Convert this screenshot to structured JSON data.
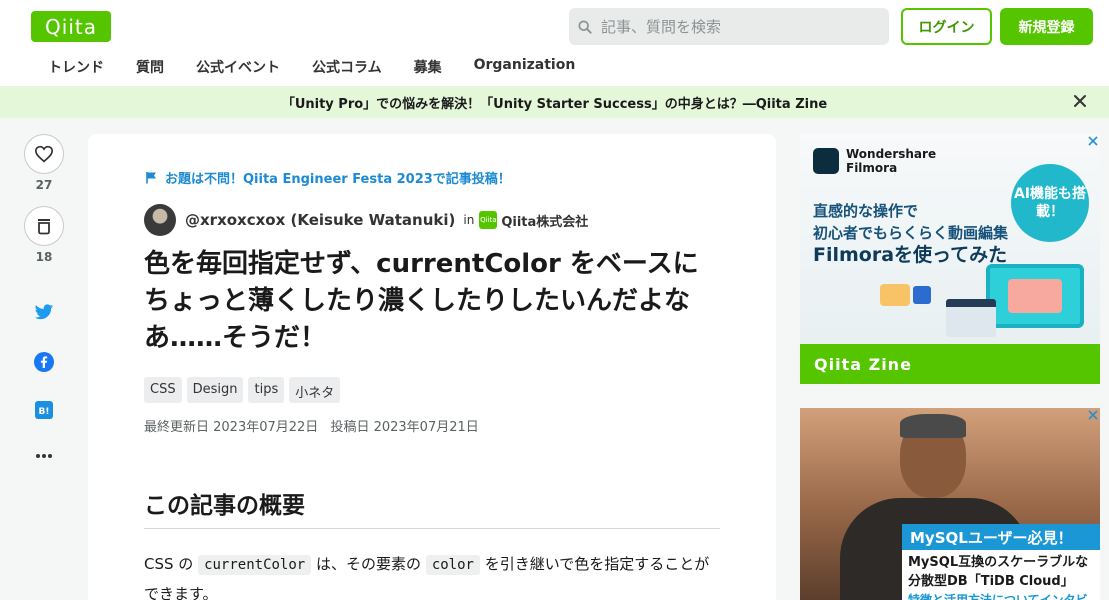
{
  "header": {
    "logo": "Qiita",
    "search_placeholder": "記事、質問を検索",
    "login": "ログイン",
    "signup": "新規登録",
    "nav": [
      "トレンド",
      "質問",
      "公式イベント",
      "公式コラム",
      "募集",
      "Organization"
    ]
  },
  "banner": {
    "text": "「Unity Pro」での悩みを解決！「Unity Starter Success」の中身とは？―Qiita Zine"
  },
  "actions": {
    "like_count": "27",
    "stock_count": "18"
  },
  "article": {
    "festa": "お題は不問！Qiita Engineer Festa 2023で記事投稿！",
    "author": "@xrxoxcxox (Keisuke Watanuki)",
    "in_label": "in",
    "org": "Qiita株式会社",
    "title": "色を毎回指定せず、currentColor をベースにちょっと薄くしたり濃くしたりしたいんだよなあ……そうだ！",
    "tags": [
      "CSS",
      "Design",
      "tips",
      "小ネタ"
    ],
    "updated": "最終更新日 2023年07月22日",
    "posted": "投稿日 2023年07月21日",
    "section_title": "この記事の概要",
    "para_1": "CSS の",
    "para_code_1": "currentColor",
    "para_2": "は、その要素の",
    "para_code_2": "color",
    "para_3": "を引き継いで色を指定することができます。"
  },
  "ads": {
    "filmora_name_1": "Wondershare",
    "filmora_name_2": "Filmora",
    "filmora_line_1": "直感的な操作で",
    "filmora_line_2": "初心者でもらくらく動画編集",
    "filmora_line_3": "Filmoraを使ってみた",
    "ai_badge": "AI機能も搭載！",
    "zine": "Qiita Zine",
    "mysql_head": "MySQLユーザー必見！",
    "mysql_line_1": "MySQL互換のスケーラブルな",
    "mysql_line_2": "分散型DB「TiDB Cloud」",
    "mysql_line_3": "特徴と活用方法についてインタビュー"
  },
  "colors": {
    "brand": "#55c500",
    "link": "#1d8bd4",
    "banner_bg": "#e4f7d9"
  }
}
